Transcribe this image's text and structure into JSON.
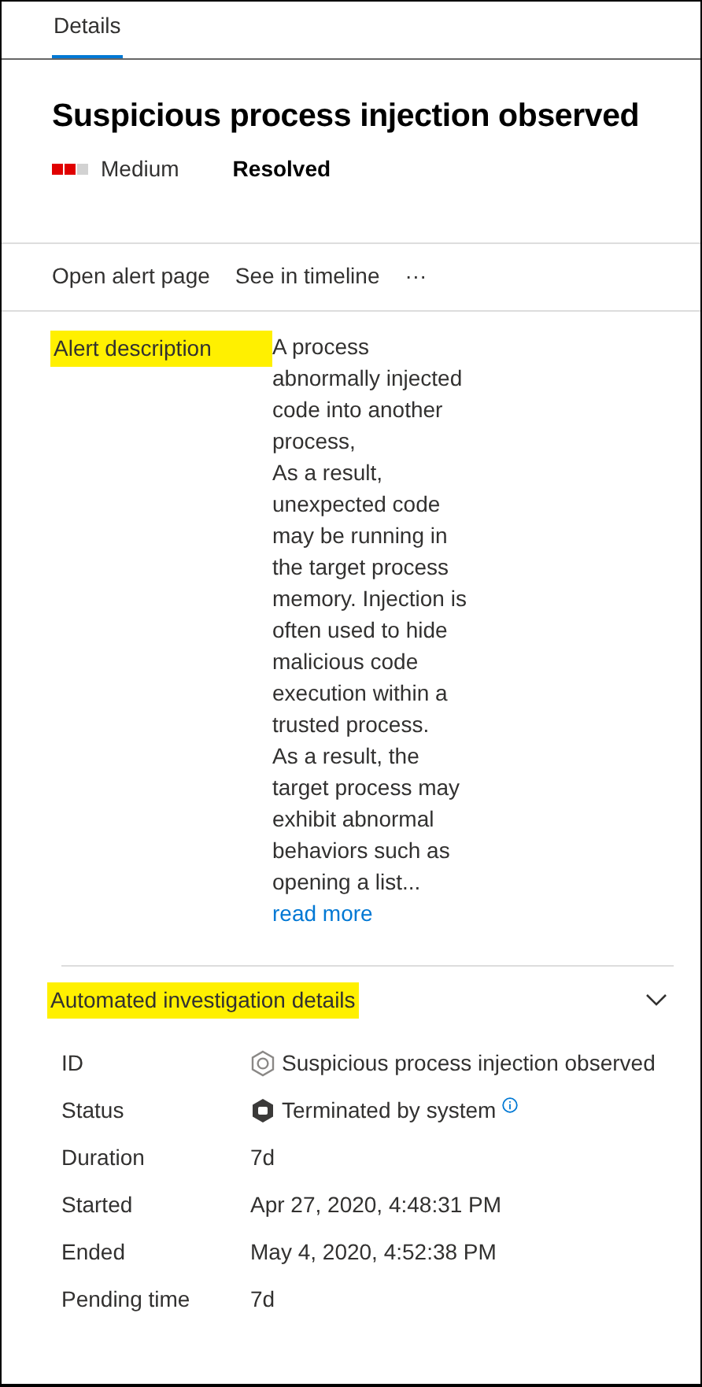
{
  "tabs": [
    {
      "label": "Details",
      "selected": true
    }
  ],
  "alert": {
    "title": "Suspicious process injection observed",
    "severity": {
      "label": "Medium",
      "stars": 2
    },
    "status": "Resolved"
  },
  "actions": [
    "Open alert page",
    "See in timeline",
    "···"
  ],
  "description": {
    "label": "Alert description",
    "highlighted": true,
    "paragraphs": [
      "A process abnormally injected code into another process,",
      "As a result, unexpected code may be running in the target process memory. Injection is often used to hide malicious code execution within a trusted process.",
      "As a result, the target process may exhibit abnormal behaviors such as opening a list..."
    ],
    "link": "read more"
  },
  "investigation": {
    "title": "Automated investigation details",
    "highlighted": true,
    "expanded": true,
    "rows": [
      {
        "label": "ID",
        "value": "Suspicious process injection observed",
        "kind": "id"
      },
      {
        "label": "Status",
        "value": "Terminated by system",
        "kind": "status"
      },
      {
        "label": "Duration",
        "value": "7d",
        "kind": "plain"
      },
      {
        "label": "Started",
        "value": "Apr 27, 2020, 4:48:31 PM",
        "kind": "plain"
      },
      {
        "label": "Ended",
        "value": "May 4, 2020, 4:52:38 PM",
        "kind": "plain"
      },
      {
        "label": "Pending time",
        "value": "7d",
        "kind": "plain"
      }
    ]
  }
}
